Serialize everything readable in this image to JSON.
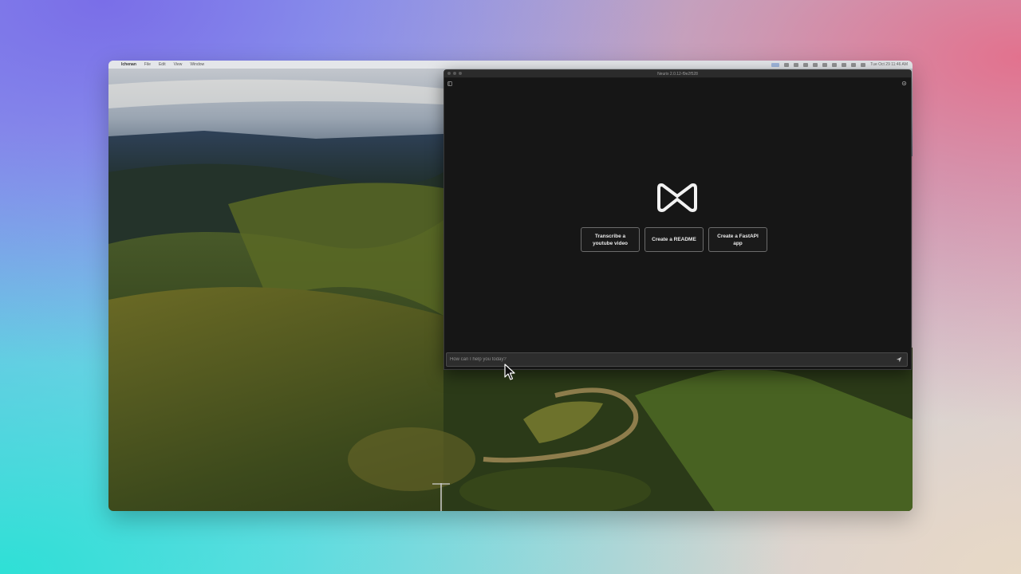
{
  "menubar": {
    "apple_glyph": "",
    "items": [
      "Ichenan",
      "File",
      "Edit",
      "View",
      "Window"
    ],
    "clock": "Tue Oct 29  11:46 AM"
  },
  "app": {
    "window_title": "Neurix 2.0.12-f9e2f528",
    "suggestions": [
      {
        "label": "Transcribe a youtube video"
      },
      {
        "label": "Create a README"
      },
      {
        "label": "Create a FastAPI app"
      }
    ],
    "composer": {
      "placeholder": "How can I help you today?",
      "value": ""
    }
  },
  "colors": {
    "window_bg": "#161616",
    "titlebar_bg": "#2b2b2b",
    "button_border": "#6b6b6b",
    "composer_bg": "#2d2d2d"
  }
}
